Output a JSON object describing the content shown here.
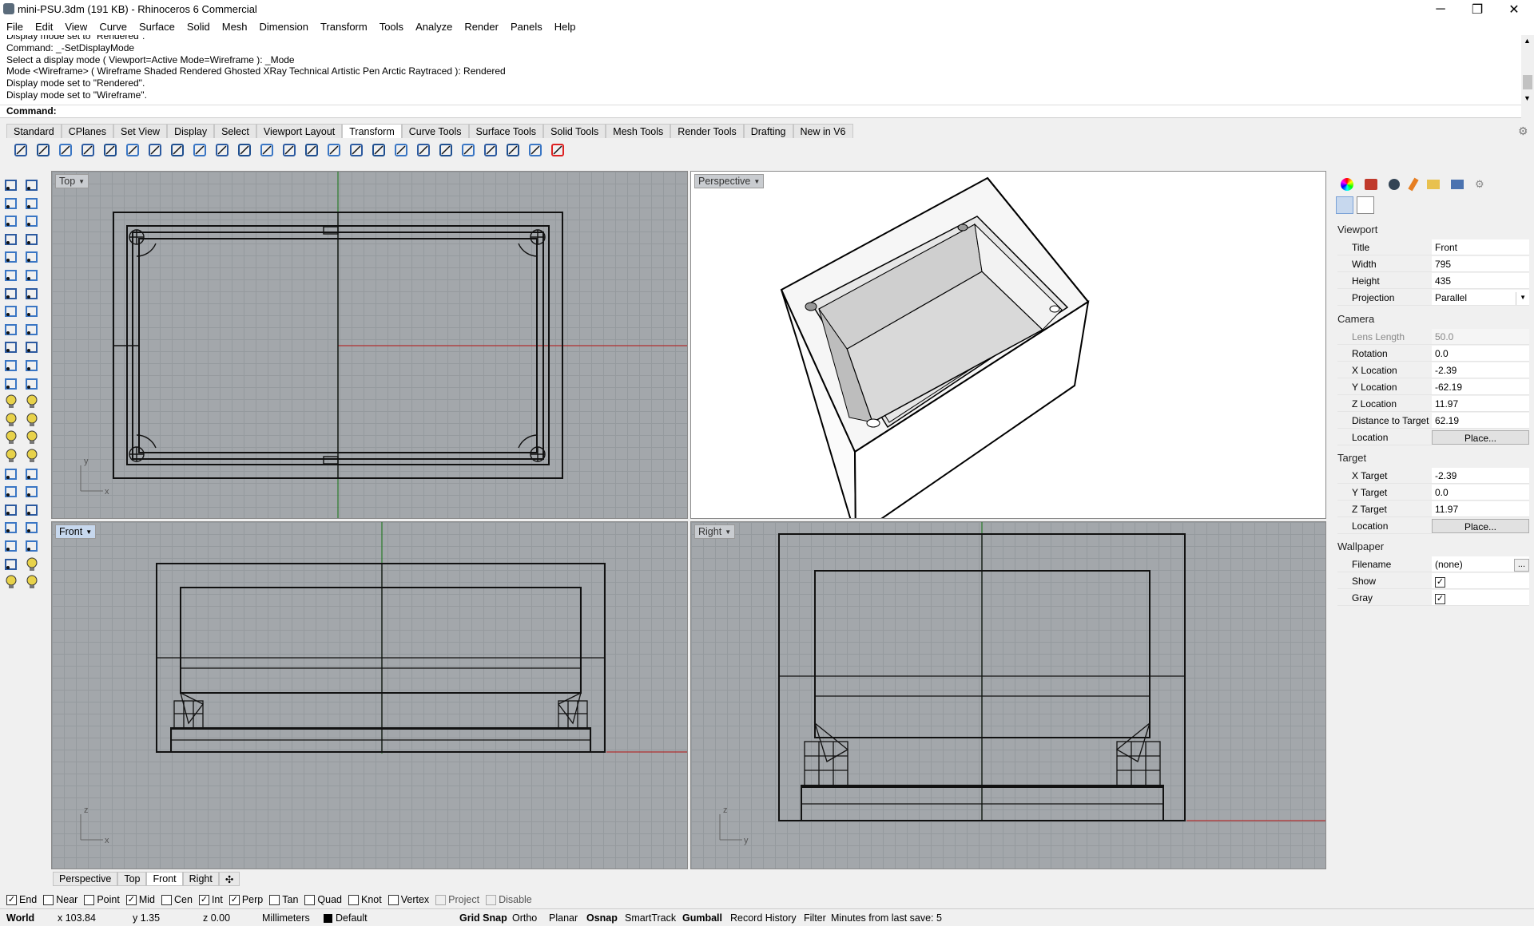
{
  "window": {
    "title": "mini-PSU.3dm (191 KB) - Rhinoceros 6 Commercial",
    "minimize": "─",
    "maximize": "❐",
    "close": "✕"
  },
  "menu": [
    "File",
    "Edit",
    "View",
    "Curve",
    "Surface",
    "Solid",
    "Mesh",
    "Dimension",
    "Transform",
    "Tools",
    "Analyze",
    "Render",
    "Panels",
    "Help"
  ],
  "command_history": [
    "Display mode set to \"Rendered\".",
    "Command: _-SetDisplayMode",
    "Select a display mode ( Viewport=Active  Mode=Wireframe ): _Mode",
    "Mode <Wireframe> ( Wireframe  Shaded  Rendered  Ghosted  XRay  Technical  Artistic  Pen  Arctic  Raytraced ): Rendered",
    "Display mode set to \"Rendered\".",
    "Display mode set to \"Wireframe\"."
  ],
  "command_prompt": "Command:",
  "toolbar_tabs": [
    "Standard",
    "CPlanes",
    "Set View",
    "Display",
    "Select",
    "Viewport Layout",
    "Transform",
    "Curve Tools",
    "Surface Tools",
    "Solid Tools",
    "Mesh Tools",
    "Render Tools",
    "Drafting",
    "New in V6"
  ],
  "active_toolbar_tab": "Transform",
  "viewports": {
    "top": "Top",
    "perspective": "Perspective",
    "front": "Front",
    "right": "Right"
  },
  "axis_labels": {
    "top_x": "x",
    "top_y": "y",
    "front_x": "x",
    "front_z": "z",
    "right_y": "y",
    "right_z": "z"
  },
  "viewport_tabs": [
    "Perspective",
    "Top",
    "Front",
    "Right"
  ],
  "viewport_tab_add": "✣",
  "properties": {
    "viewport_header": "Viewport",
    "title_label": "Title",
    "title_value": "Front",
    "width_label": "Width",
    "width_value": "795",
    "height_label": "Height",
    "height_value": "435",
    "projection_label": "Projection",
    "projection_value": "Parallel",
    "camera_header": "Camera",
    "lens_label": "Lens Length",
    "lens_value": "50.0",
    "rotation_label": "Rotation",
    "rotation_value": "0.0",
    "xloc_label": "X Location",
    "xloc_value": "-2.39",
    "yloc_label": "Y Location",
    "yloc_value": "-62.19",
    "zloc_label": "Z Location",
    "zloc_value": "11.97",
    "dist_label": "Distance to Target",
    "dist_value": "62.19",
    "location_label": "Location",
    "place_button": "Place...",
    "target_header": "Target",
    "xt_label": "X Target",
    "xt_value": "-2.39",
    "yt_label": "Y Target",
    "yt_value": "0.0",
    "zt_label": "Z Target",
    "zt_value": "11.97",
    "tloc_label": "Location",
    "tplace_button": "Place...",
    "wallpaper_header": "Wallpaper",
    "filename_label": "Filename",
    "filename_value": "(none)",
    "browse_button": "...",
    "show_label": "Show",
    "gray_label": "Gray"
  },
  "osnaps": [
    {
      "label": "End",
      "checked": true
    },
    {
      "label": "Near",
      "checked": false
    },
    {
      "label": "Point",
      "checked": false
    },
    {
      "label": "Mid",
      "checked": true
    },
    {
      "label": "Cen",
      "checked": false
    },
    {
      "label": "Int",
      "checked": true
    },
    {
      "label": "Perp",
      "checked": true
    },
    {
      "label": "Tan",
      "checked": false
    },
    {
      "label": "Quad",
      "checked": false
    },
    {
      "label": "Knot",
      "checked": false
    },
    {
      "label": "Vertex",
      "checked": false
    },
    {
      "label": "Project",
      "checked": false
    },
    {
      "label": "Disable",
      "checked": false
    }
  ],
  "status": {
    "cplane": "World",
    "x": "x 103.84",
    "y": "y 1.35",
    "z": "z 0.00",
    "units": "Millimeters",
    "layer": "Default",
    "grid_snap": "Grid Snap",
    "ortho": "Ortho",
    "planar": "Planar",
    "osnap": "Osnap",
    "smarttrack": "SmartTrack",
    "gumball": "Gumball",
    "record_history": "Record History",
    "filter": "Filter",
    "save_info": "Minutes from last save: 5"
  },
  "colors": {
    "viewport_bg": "#a3a7ab",
    "grid": "#959a9e",
    "x_axis": "#b03030",
    "y_axis": "#2a7a2a",
    "active_label": "#c7d8ee"
  }
}
